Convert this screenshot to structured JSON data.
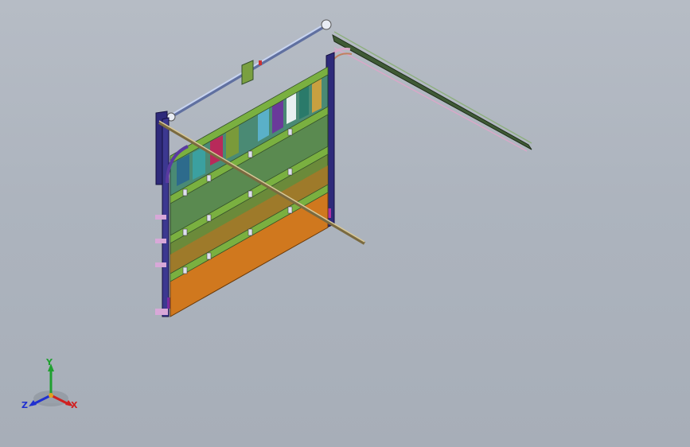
{
  "viewport": {
    "background_top": "#b6bcc5",
    "background_bottom": "#a7aeb8"
  },
  "model": {
    "frame_color": "#2e2a7a",
    "panel_green": "#6f9a3c",
    "panel_orange": "#d0781e",
    "track_color": "#3f5a35",
    "shaft_color": "#9fb0d8",
    "strut_color": "#b5a070"
  },
  "triad": {
    "x_label": "X",
    "y_label": "Y",
    "z_label": "Z",
    "x_color": "#d02020",
    "y_color": "#20a030",
    "z_color": "#2030d0"
  }
}
